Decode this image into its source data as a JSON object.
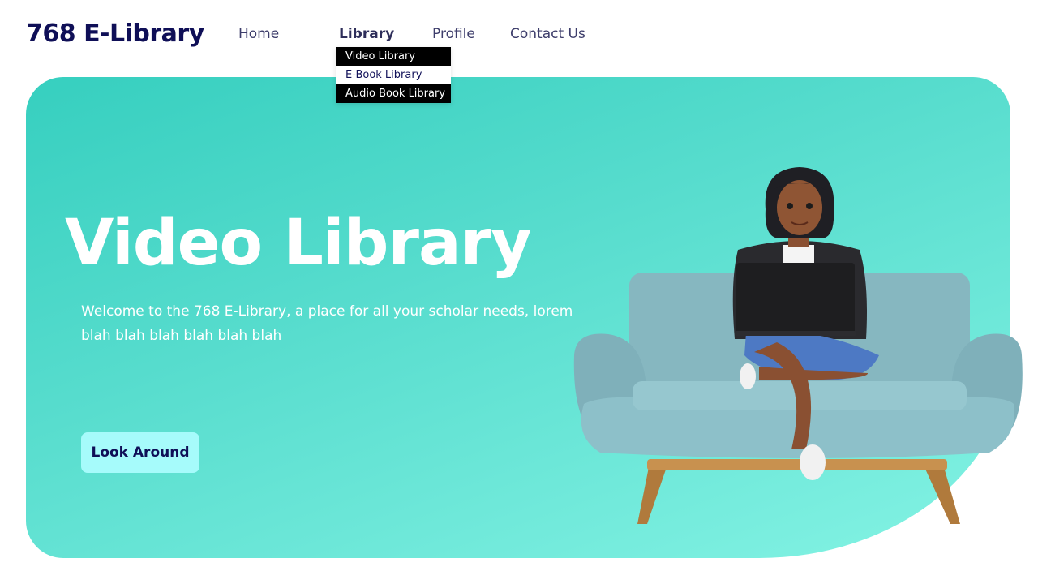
{
  "header": {
    "brand": "768 E-Library",
    "nav": {
      "home": "Home",
      "library": "Library",
      "profile": "Profile",
      "contact": "Contact Us"
    },
    "dropdown": {
      "video": "Video Library",
      "ebook": "E-Book Library",
      "audio": "Audio Book Library"
    }
  },
  "hero": {
    "title": "Video Library",
    "description": "Welcome to the 768 E-Library, a place for all your scholar needs, lorem blah blah blah blah blah blah",
    "cta_label": "Look Around",
    "illustration_icon": "woman-on-sofa-with-laptop-illustration"
  },
  "colors": {
    "brand": "#0f0f57",
    "hero_start": "#36cfbf",
    "hero_end": "#84f3e4",
    "cta_bg": "#a6fbfb",
    "dropdown_bg": "#000000"
  }
}
